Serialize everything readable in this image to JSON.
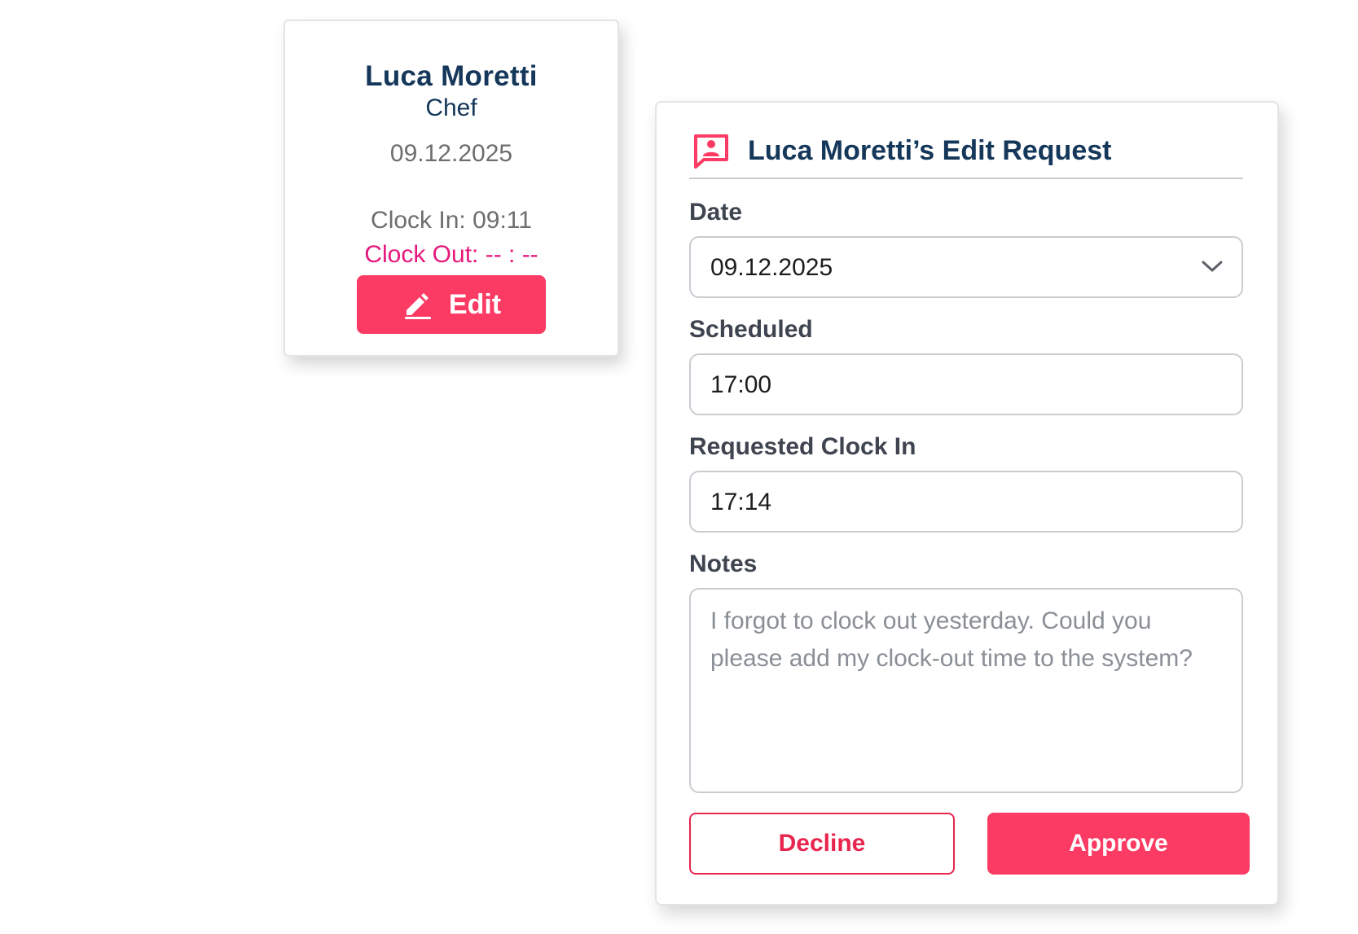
{
  "employee_card": {
    "name": "Luca Moretti",
    "role": "Chef",
    "date": "09.12.2025",
    "clock_in": "Clock In: 09:11",
    "clock_out": "Clock Out: -- : --",
    "edit_label": "Edit",
    "edit_icon": "pencil-icon"
  },
  "request_panel": {
    "title": "Luca Moretti’s Edit Request",
    "header_icon": "person-message-icon",
    "date": {
      "label": "Date",
      "value": "09.12.2025",
      "icon": "chevron-down-icon"
    },
    "scheduled": {
      "label": "Scheduled",
      "value": "17:00"
    },
    "requested_clock_in": {
      "label": "Requested Clock In",
      "value": "17:14"
    },
    "notes": {
      "label": "Notes",
      "value": "I forgot to clock out yesterday. Could you please add my clock-out time to the system?"
    },
    "decline_label": "Decline",
    "approve_label": "Approve"
  },
  "colors": {
    "brand_red": "#fb3b63",
    "clock_out_pink": "#e6187c",
    "navy": "#14375a"
  }
}
